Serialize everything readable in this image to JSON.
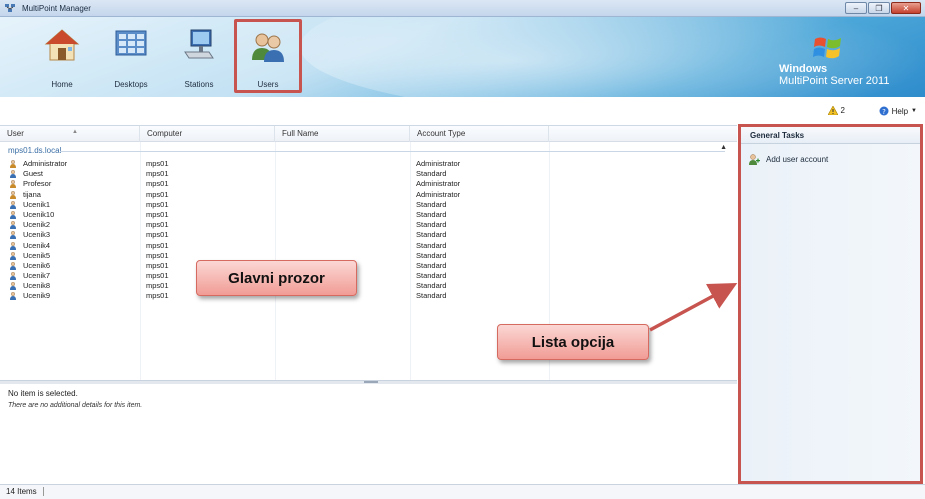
{
  "window": {
    "title": "MultiPoint Manager",
    "buttons": [
      "minimize",
      "restore",
      "close"
    ]
  },
  "nav": {
    "home": "Home",
    "desktops": "Desktops",
    "stations": "Stations",
    "users": "Users",
    "selected": "users"
  },
  "brand": {
    "line1": "Windows",
    "line2": "MultiPoint Server 2011"
  },
  "toolbar": {
    "warning_count": "2",
    "help_label": "Help"
  },
  "table": {
    "columns": [
      "User",
      "Computer",
      "Full Name",
      "Account Type"
    ],
    "group": "mps01.ds.local",
    "rows": [
      {
        "user": "Administrator",
        "computer": "mps01",
        "full_name": "",
        "account_type": "Administrator",
        "icon": "admin-user-icon"
      },
      {
        "user": "Guest",
        "computer": "mps01",
        "full_name": "",
        "account_type": "Standard",
        "icon": "user-icon"
      },
      {
        "user": "Profesor",
        "computer": "mps01",
        "full_name": "",
        "account_type": "Administrator",
        "icon": "admin-user-icon"
      },
      {
        "user": "tijana",
        "computer": "mps01",
        "full_name": "",
        "account_type": "Administrator",
        "icon": "admin-user-icon"
      },
      {
        "user": "Ucenik1",
        "computer": "mps01",
        "full_name": "",
        "account_type": "Standard",
        "icon": "user-icon"
      },
      {
        "user": "Ucenik10",
        "computer": "mps01",
        "full_name": "",
        "account_type": "Standard",
        "icon": "user-icon"
      },
      {
        "user": "Ucenik2",
        "computer": "mps01",
        "full_name": "",
        "account_type": "Standard",
        "icon": "user-icon"
      },
      {
        "user": "Ucenik3",
        "computer": "mps01",
        "full_name": "",
        "account_type": "Standard",
        "icon": "user-icon"
      },
      {
        "user": "Ucenik4",
        "computer": "mps01",
        "full_name": "",
        "account_type": "Standard",
        "icon": "user-icon"
      },
      {
        "user": "Ucenik5",
        "computer": "mps01",
        "full_name": "",
        "account_type": "Standard",
        "icon": "user-icon"
      },
      {
        "user": "Ucenik6",
        "computer": "mps01",
        "full_name": "",
        "account_type": "Standard",
        "icon": "user-icon"
      },
      {
        "user": "Ucenik7",
        "computer": "mps01",
        "full_name": "",
        "account_type": "Standard",
        "icon": "user-icon"
      },
      {
        "user": "Ucenik8",
        "computer": "mps01",
        "full_name": "",
        "account_type": "Standard",
        "icon": "user-icon"
      },
      {
        "user": "Ucenik9",
        "computer": "mps01",
        "full_name": "",
        "account_type": "Standard",
        "icon": "user-icon"
      }
    ]
  },
  "details": {
    "title": "No item is selected.",
    "message": "There are no additional details for this item."
  },
  "tasks": {
    "header": "General Tasks",
    "items": [
      "Add user account"
    ]
  },
  "status": {
    "items_count": "14 Items"
  },
  "annotations": {
    "main_window": "Glavni prozor",
    "options_list": "Lista opcija",
    "highlight_color": "#c8544f"
  }
}
